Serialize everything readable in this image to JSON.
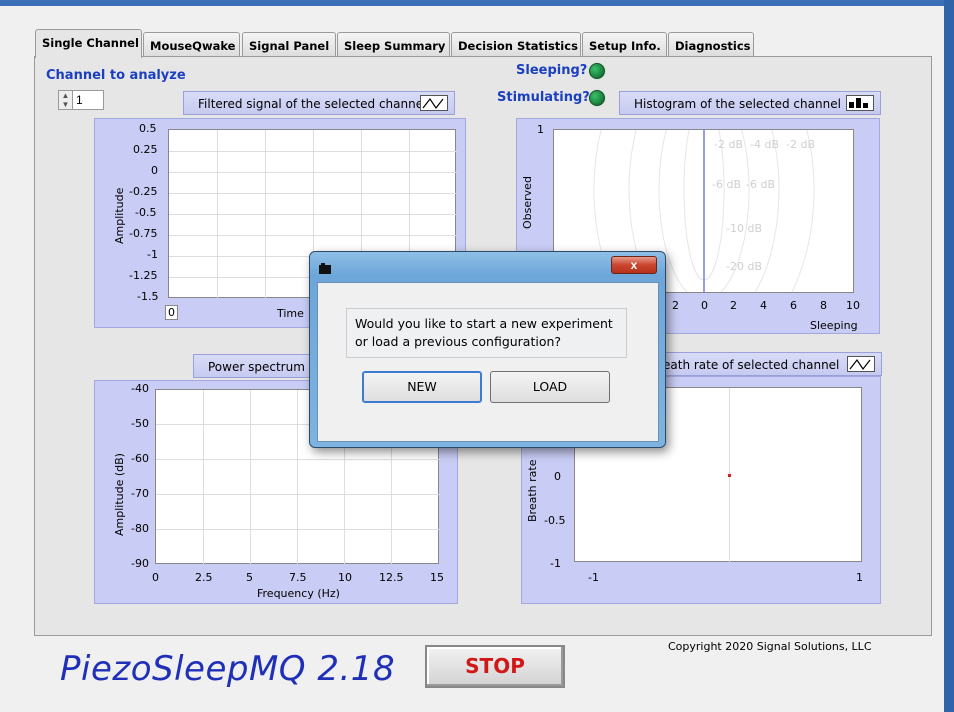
{
  "tabs": [
    {
      "label": "Single Channel",
      "active": true
    },
    {
      "label": "MouseQwake"
    },
    {
      "label": "Signal Panel"
    },
    {
      "label": "Sleep Summary"
    },
    {
      "label": "Decision Statistics"
    },
    {
      "label": "Setup Info."
    },
    {
      "label": "Diagnostics"
    }
  ],
  "channel": {
    "label": "Channel to analyze",
    "value": "1"
  },
  "indicators": {
    "sleeping": "Sleeping?",
    "stimulating": "Stimulating?",
    "led_color": "#1e8a45"
  },
  "filtered_plot": {
    "title": "Filtered signal of the selected channel",
    "ylabel": "Amplitude",
    "xlabel": "Time",
    "x_start": "0",
    "yticks": [
      "0.5",
      "0.25",
      "0",
      "-0.25",
      "-0.5",
      "-0.75",
      "-1",
      "-1.25",
      "-1.5"
    ]
  },
  "histogram_plot": {
    "title": "Histogram of the selected channel",
    "ylabel": "Observed",
    "xlabel": "Sleeping",
    "y_top": "1",
    "xticks": [
      "2",
      "0",
      "2",
      "4",
      "6",
      "8",
      "10"
    ],
    "contours": [
      "-2 dB",
      "-4 dB",
      "-2 dB",
      "-6 dB",
      "-6 dB",
      "-10 dB",
      "-20 dB"
    ]
  },
  "power_plot": {
    "title": "Power spectrum o",
    "ylabel": "Amplitude (dB)",
    "xlabel": "Frequency (Hz)",
    "yticks": [
      "-40",
      "-50",
      "-60",
      "-70",
      "-80",
      "-90"
    ],
    "xticks": [
      "0",
      "2.5",
      "5",
      "7.5",
      "10",
      "12.5",
      "15"
    ]
  },
  "breath_plot": {
    "title": "eath rate of selected channel",
    "ylabel": "Breath rate",
    "yticks": [
      "0",
      "-0.5",
      "-1"
    ],
    "xticks": [
      "-1",
      "1"
    ]
  },
  "dialog": {
    "message_line1": "Would you like to start a new experiment",
    "message_line2": "or load a previous configuration?",
    "new_label": "NEW",
    "load_label": "LOAD",
    "close_label": "x"
  },
  "footer": {
    "app_name": "PiezoSleepMQ 2.18",
    "stop_label": "STOP",
    "copyright": "Copyright 2020 Signal Solutions, LLC"
  }
}
